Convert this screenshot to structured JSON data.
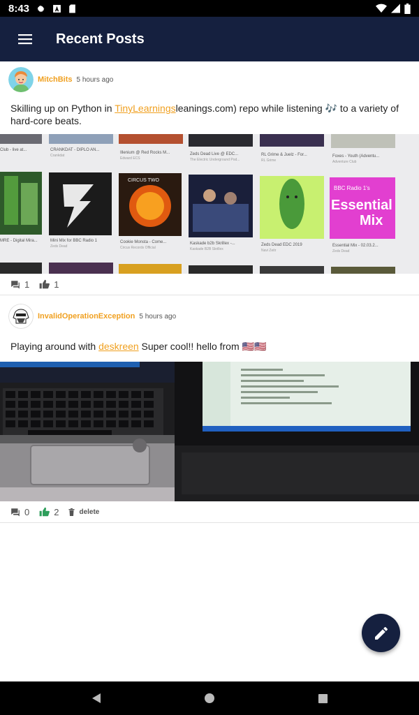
{
  "status_bar": {
    "time": "8:43"
  },
  "app_bar": {
    "title": "Recent Posts"
  },
  "posts": [
    {
      "author": "MitchBits",
      "time": "5 hours ago",
      "text_before": "Skilling up on Python in ",
      "link": "TinyLearnings",
      "text_after": "leanings.com) repo while listening 🎶 to a variety of hard-core beats.",
      "comments": "1",
      "likes": "1",
      "tiles": [
        {
          "title": "Club - live at...",
          "sub": ""
        },
        {
          "title": "CRANKDAT - DIPLO AN...",
          "sub": "Crankdat"
        },
        {
          "title": "Illenium @ Red Rocks M...",
          "sub": "Edward ECS"
        },
        {
          "title": "Zeds Dead Live @ EDC...",
          "sub": "The Electric Underground Pod..."
        },
        {
          "title": "RL Grime & Juelz - For...",
          "sub": "RL Grime"
        },
        {
          "title": "Foxes - Youth (Adventu...",
          "sub": "Adventure Club"
        },
        {
          "title": "MRE - Digital Mira...",
          "sub": ""
        },
        {
          "title": "Mini Mix for BBC Radio 1",
          "sub": "Zeds Dead"
        },
        {
          "title": "Cookie Monsta - Come...",
          "sub": "Circus Records Official"
        },
        {
          "title": "Kaskade b2b Skrillex -...",
          "sub": "Kaskade B2B Skrillex"
        },
        {
          "title": "Zeds Dead EDC 2019",
          "sub": "Navi Zeitr"
        },
        {
          "title": "Essential Mix - 02.03.2...",
          "sub": "Zeds Dead"
        }
      ],
      "cover_text": {
        "essential_small": "BBC Radio 1's",
        "essential_big": "Essential Mix",
        "circus": "CIRCUS TWO"
      }
    },
    {
      "author": "InvalidOperationException",
      "time": "5 hours ago",
      "text_before": "Playing around with ",
      "link": "deskreen",
      "text_after": " Super cool!! hello from 🇺🇸🇺🇸",
      "comments": "0",
      "likes": "2",
      "delete_label": "delete"
    }
  ],
  "colors": {
    "app_bar": "#15203f",
    "author": "#f0a020",
    "liked": "#2e9e5b"
  }
}
